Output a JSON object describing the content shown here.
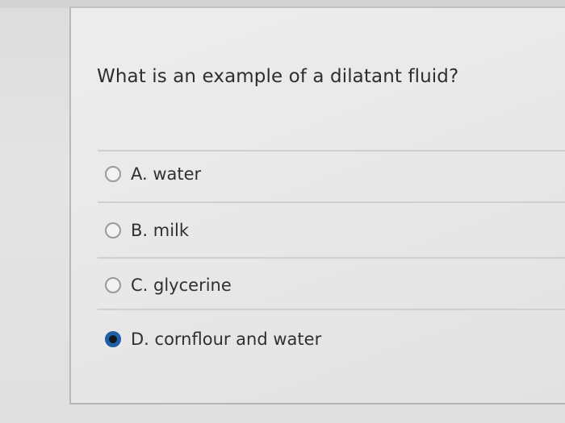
{
  "question": {
    "text": "What is an example of a dilatant fluid?"
  },
  "options": [
    {
      "label": "A. water",
      "selected": false
    },
    {
      "label": "B. milk",
      "selected": false
    },
    {
      "label": "C. glycerine",
      "selected": false
    },
    {
      "label": "D. cornflour and water",
      "selected": true
    }
  ],
  "colors": {
    "selected_radio": "#1f5fa8"
  }
}
